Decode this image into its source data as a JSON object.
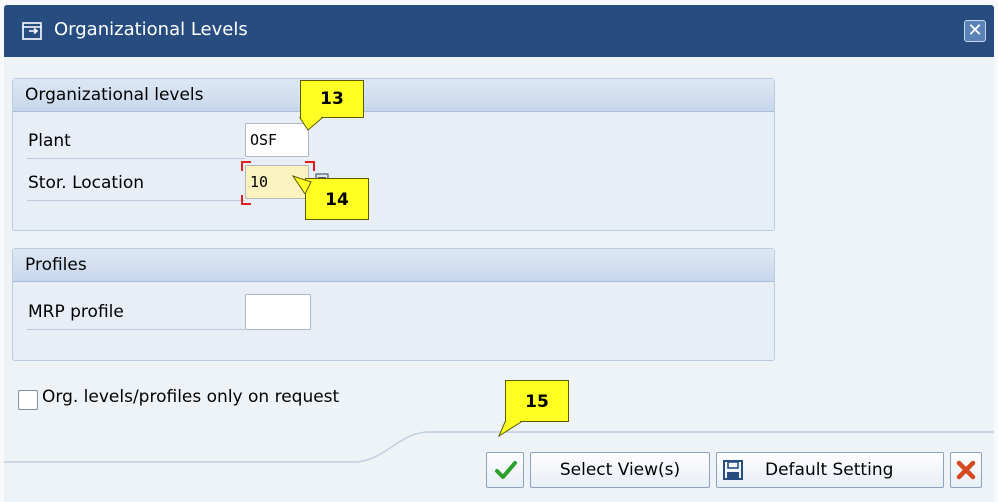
{
  "window": {
    "title": "Organizational Levels",
    "close_symbol": "✕"
  },
  "group_org": {
    "header": "Organizational levels",
    "plant_label": "Plant",
    "plant_value": "OSF",
    "stor_label": "Stor. Location",
    "stor_value": "10"
  },
  "group_profiles": {
    "header": "Profiles",
    "mrp_label": "MRP profile",
    "mrp_value": ""
  },
  "checkbox": {
    "label": "Org. levels/profiles only on request",
    "checked": false
  },
  "buttons": {
    "confirm_icon": "check-icon",
    "select_views": "Select View(s)",
    "default_setting": "Default Setting",
    "cancel_icon": "cancel-icon"
  },
  "callouts": {
    "c13": "13",
    "c14": "14",
    "c15": "15"
  },
  "colors": {
    "titlebar": "#274d80",
    "callout": "#ffff24",
    "focus_field": "#fbf3bf",
    "check": "#2aa12a",
    "cancel": "#d64a1f"
  }
}
